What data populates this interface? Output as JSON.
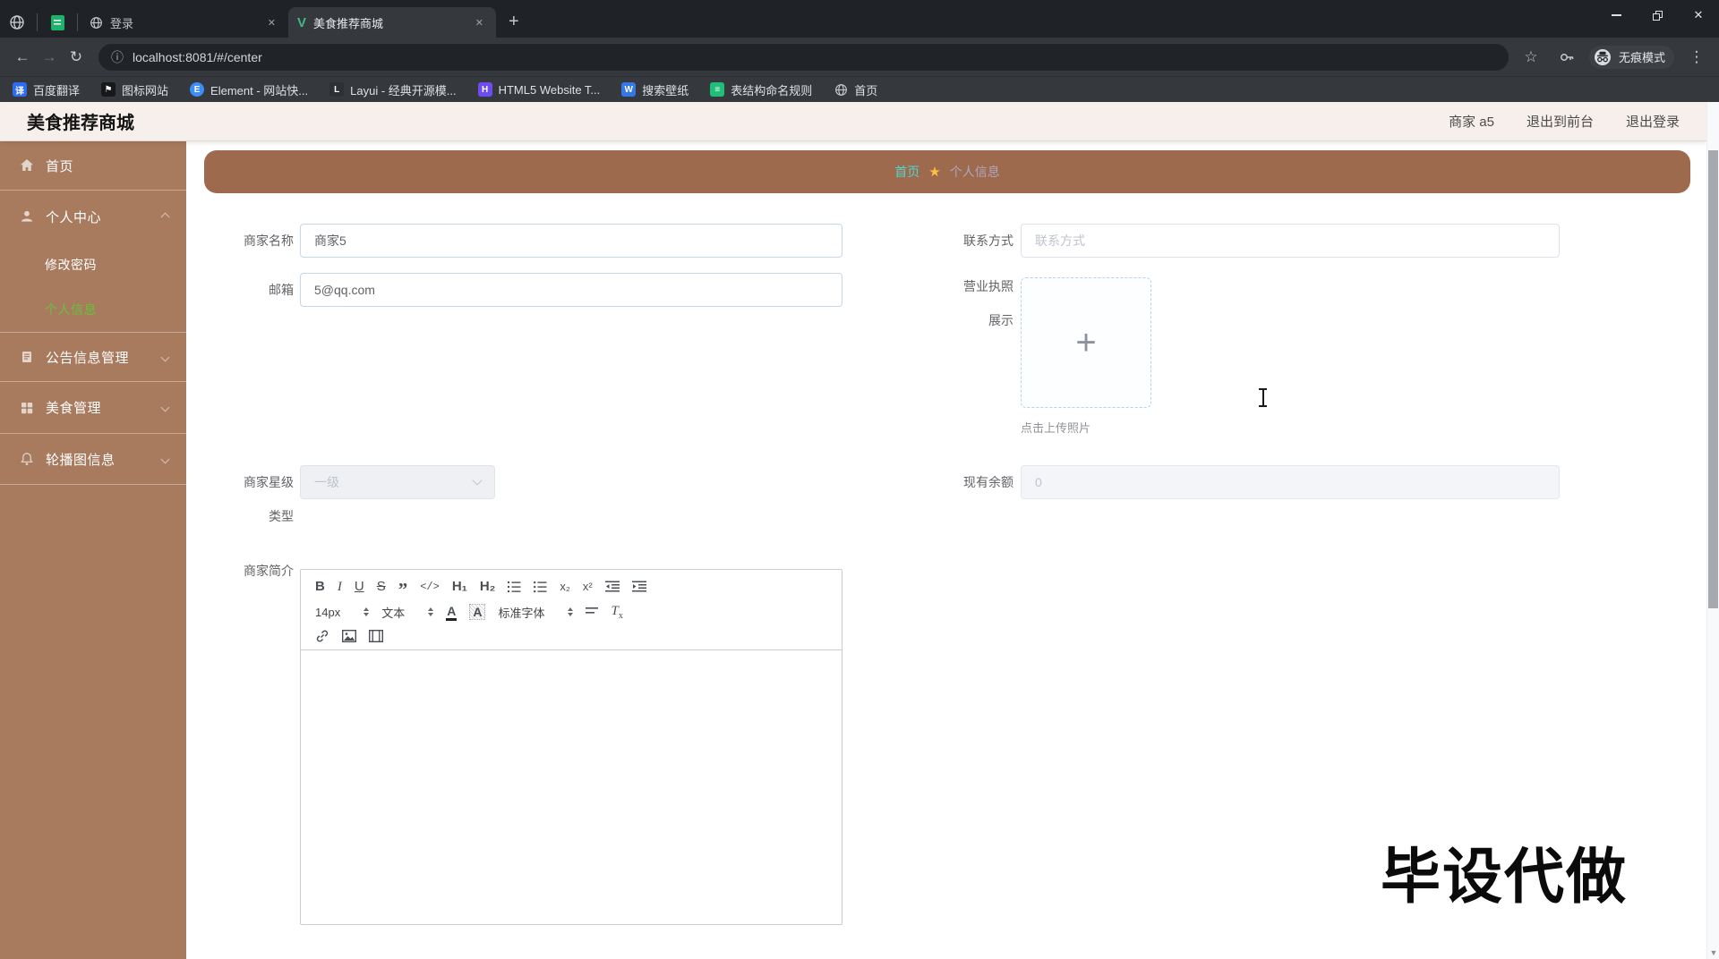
{
  "glyphs": {
    "close": "✕",
    "plus": "+",
    "back": "←",
    "forward": "→",
    "reload": "↻",
    "info": "ⓘ",
    "star_outline": "☆",
    "menu": "⋮",
    "sb_arrow": "▼"
  },
  "browser": {
    "pinned_tab_icons": [
      "globe-icon",
      "sheet-icon"
    ],
    "tabs": [
      {
        "title": "登录",
        "favicon": "globe-icon"
      },
      {
        "title": "美食推荐商城",
        "favicon": "V"
      }
    ],
    "url": "localhost:8081/#/center",
    "incognito_label": "无痕模式",
    "bookmarks": [
      {
        "label": "百度翻译",
        "glyph": "译"
      },
      {
        "label": "图标网站",
        "glyph": "⚑"
      },
      {
        "label": "Element - 网站快...",
        "glyph": "E"
      },
      {
        "label": "Layui - 经典开源模...",
        "glyph": "L"
      },
      {
        "label": "HTML5 Website T...",
        "glyph": "H"
      },
      {
        "label": "搜索壁纸",
        "glyph": "W"
      },
      {
        "label": "表结构命名规则",
        "glyph": "≡"
      },
      {
        "label": "首页",
        "glyph": ""
      }
    ]
  },
  "app": {
    "header": {
      "title": "美食推荐商城",
      "user": "商家 a5",
      "to_front": "退出到前台",
      "logout": "退出登录"
    },
    "sidebar": {
      "home": "首页",
      "center": "个人中心",
      "change_pwd": "修改密码",
      "profile": "个人信息",
      "notice": "公告信息管理",
      "food": "美食管理",
      "carousel": "轮播图信息"
    },
    "breadcrumb": {
      "home": "首页",
      "star": "★",
      "current": "个人信息"
    },
    "form": {
      "merchant_name": {
        "label": "商家名称",
        "value": "商家5"
      },
      "contact": {
        "label": "联系方式",
        "placeholder": "联系方式"
      },
      "email": {
        "label": "邮箱",
        "value": "5@qq.com"
      },
      "license": {
        "label1": "营业执照",
        "label2": "展示",
        "plus": "+",
        "hint": "点击上传照片"
      },
      "star_level": {
        "label1": "商家星级",
        "label2": "类型",
        "value": "一级"
      },
      "balance": {
        "label": "现有余额",
        "value": "0"
      },
      "intro": {
        "label": "商家简介"
      }
    },
    "editor": {
      "bold": "B",
      "italic": "I",
      "underline": "U",
      "strike": "S",
      "quote": "”",
      "code": "</>",
      "h1": "H₁",
      "h2": "H₂",
      "sub": "x₂",
      "sup": "x²",
      "size": "14px",
      "text": "文本",
      "color": "A",
      "background": "A",
      "font": "标准字体",
      "clear_t": "T",
      "clear_x": "x",
      "shape_icons": [
        "ordered-list-icon",
        "bullet-list-icon",
        "outdent-icon",
        "indent-icon",
        "line-height-icon",
        "link-icon",
        "image-icon",
        "video-icon"
      ]
    },
    "watermark": "毕设代做"
  },
  "colors": {
    "sidebar_bg": "#a87b5e",
    "breadcrumb_bg": "#9e6a4d",
    "active_menu_green": "#67c23a",
    "breadcrumb_home_teal": "#4fd6cd",
    "star_yellow": "#f6c243",
    "header_bg": "#f7efec",
    "chrome_dark": "#1f2226",
    "chrome_toolbar": "#35383c"
  }
}
